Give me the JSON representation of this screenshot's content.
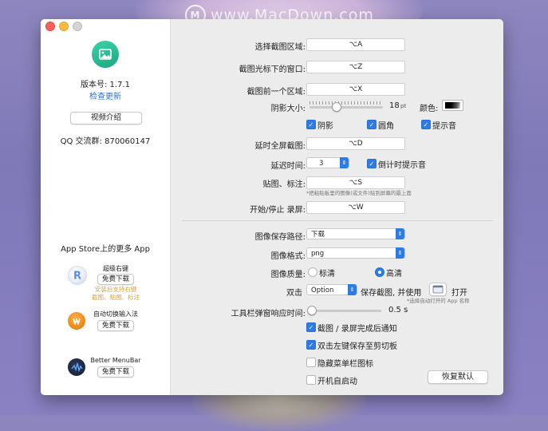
{
  "watermark": "www.MacDown.com",
  "sidebar": {
    "version": "版本号: 1.7.1",
    "check_update": "检查更新",
    "video_button": "视频介绍",
    "qq_group": "QQ 交流群:  870060147",
    "more_apps": "App Store上的更多 App",
    "apps": [
      {
        "name": "超级右键",
        "button": "免费下载",
        "subtitle_lines": [
          "安装后支持右键",
          "截图、贴图、标注"
        ]
      },
      {
        "name": "自动切换输入法",
        "button": "免费下载"
      },
      {
        "name": "Better MenuBar",
        "button": "免费下载"
      }
    ]
  },
  "settings": {
    "select_area": {
      "label": "选择截图区域:",
      "shortcut": "⌥A"
    },
    "window_under_cursor": {
      "label": "截图光标下的窗口:",
      "shortcut": "⌥Z"
    },
    "previous_area": {
      "label": "截图前一个区域:",
      "shortcut": "⌥X"
    },
    "shadow_size": {
      "label": "阴影大小:",
      "value": "18",
      "unit": "pt",
      "level": 18
    },
    "color_label": "颜色:",
    "shadow_cb": {
      "label": "阴影",
      "checked": true
    },
    "rounded_cb": {
      "label": "圆角",
      "checked": true
    },
    "sound_cb": {
      "label": "提示音",
      "checked": true
    },
    "delay_fullscreen": {
      "label": "延时全屏截图:",
      "shortcut": "⌥D"
    },
    "delay_time": {
      "label": "延迟时间:",
      "value": "3"
    },
    "countdown_cb": {
      "label": "倒计时提示音",
      "checked": true
    },
    "pin_annotate": {
      "label": "贴图、标注:",
      "shortcut": "⌥S",
      "note": "*把粘贴板里的图像(或文件)贴到屏幕的最上面"
    },
    "record": {
      "label": "开始/停止 录屏:",
      "shortcut": "⌥W"
    },
    "save_path": {
      "label": "图像保存路径:",
      "value": "下载"
    },
    "image_format": {
      "label": "图像格式:",
      "value": "png"
    },
    "quality": {
      "label": "图像质量:",
      "options": [
        "标清",
        "高清"
      ],
      "selected": "高清"
    },
    "double_click": {
      "label": "双击",
      "value": "Option",
      "action": "保存截图, 并使用",
      "open": "打开",
      "note": "*选择自动打开的 App 名称"
    },
    "toolbar_delay": {
      "label": "工具栏弹窗响应时间:",
      "value": "0.5 s",
      "level": 0.5
    },
    "notify_cb": {
      "label": "截图 / 录屏完成后通知",
      "checked": true
    },
    "clipboard_cb": {
      "label": "双击左键保存至剪切板",
      "checked": true
    },
    "hide_menubar_cb": {
      "label": "隐藏菜单栏图标",
      "checked": false
    },
    "launch_cb": {
      "label": "开机自启动",
      "checked": false
    },
    "restore_button": "恢复默认"
  },
  "colors": {
    "accent": "#2f7be6",
    "link": "#2b6fd6",
    "app_icon": "#27c197",
    "promo_subtitle": "#e0a33a"
  }
}
